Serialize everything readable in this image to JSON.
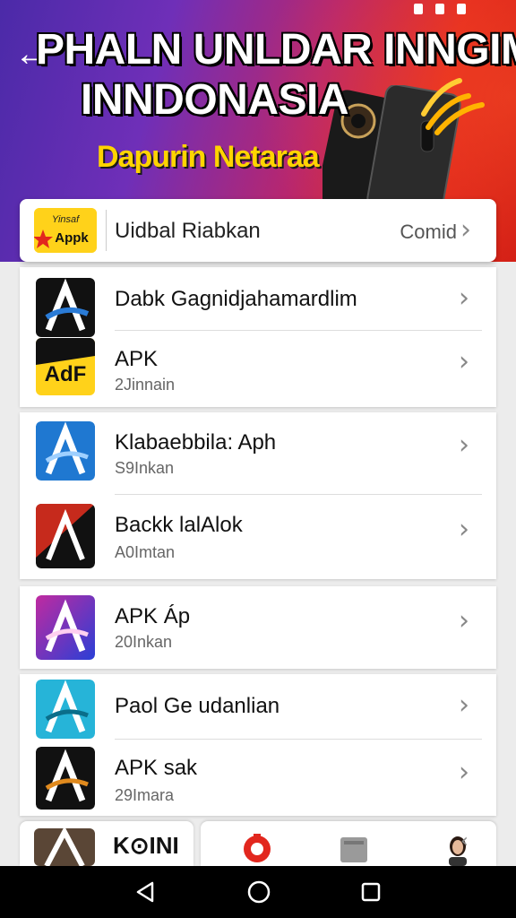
{
  "banner": {
    "headline_line1": "PHALN UNLDAR INNGIM",
    "headline_line2": "INNDONASIA",
    "subhead": "Dapurin Netaraa"
  },
  "top_row": {
    "icon_text_1": "Yinsaf",
    "icon_text_2": "Appk",
    "title": "Uidbal Riabkan",
    "action": "Comid"
  },
  "apps": [
    {
      "title": "Dabk Gagnidjahamardlim",
      "subtitle": "",
      "icon": "a-logo-black-icon"
    },
    {
      "title": "APK",
      "subtitle": "2Jinnain",
      "icon": "adf-yellow-icon",
      "icon_text": "AdF"
    },
    {
      "title": "Klabaebbila: Aph",
      "subtitle": "S9Inkan",
      "icon": "a-logo-blue-icon"
    },
    {
      "title": "Backk lalAlok",
      "subtitle": "A0Imtan",
      "icon": "a-logo-red-icon"
    },
    {
      "title": "APK Áp",
      "subtitle": "20Inkan",
      "icon": "a-logo-gradient-icon"
    },
    {
      "title": "Paol Ge udanlian",
      "subtitle": "",
      "icon": "a-logo-teal-icon"
    },
    {
      "title": "APK sak",
      "subtitle": "29Imara",
      "icon": "a-logo-black-gold-icon"
    }
  ],
  "bottom": {
    "left_label": "K⊙INI"
  },
  "colors": {
    "accent_red": "#e2271e",
    "accent_purple": "#4b2aa8",
    "highlight_yellow": "#ffd400"
  }
}
